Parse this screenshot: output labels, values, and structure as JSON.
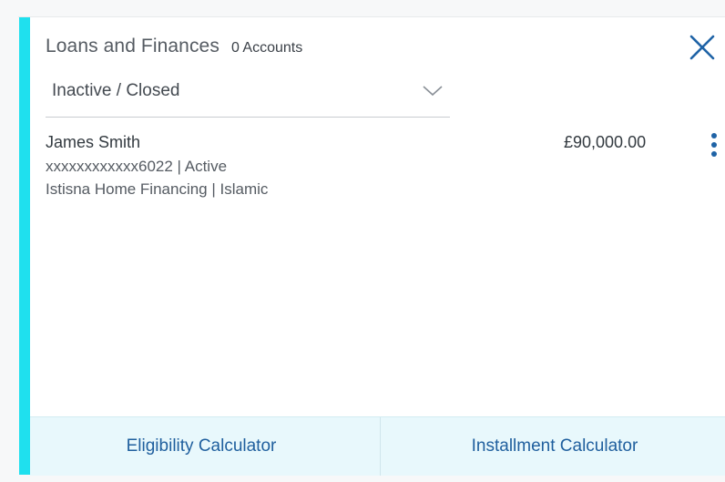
{
  "widget": {
    "title": "Loans and Finances",
    "accounts_count": "0 Accounts",
    "close_icon": "close-icon",
    "accent_color": "#1fe0ee"
  },
  "filter": {
    "selected": "Inactive / Closed",
    "icon": "chevron-down-icon"
  },
  "accounts": [
    {
      "name": "James Smith",
      "number_status": "xxxxxxxxxxxx6022 | Active",
      "product": "Istisna Home Financing | Islamic",
      "amount": "£90,000.00",
      "menu_icon": "more-vertical-icon"
    }
  ],
  "footer": {
    "eligibility_label": "Eligibility Calculator",
    "installment_label": "Installment Calculator"
  }
}
